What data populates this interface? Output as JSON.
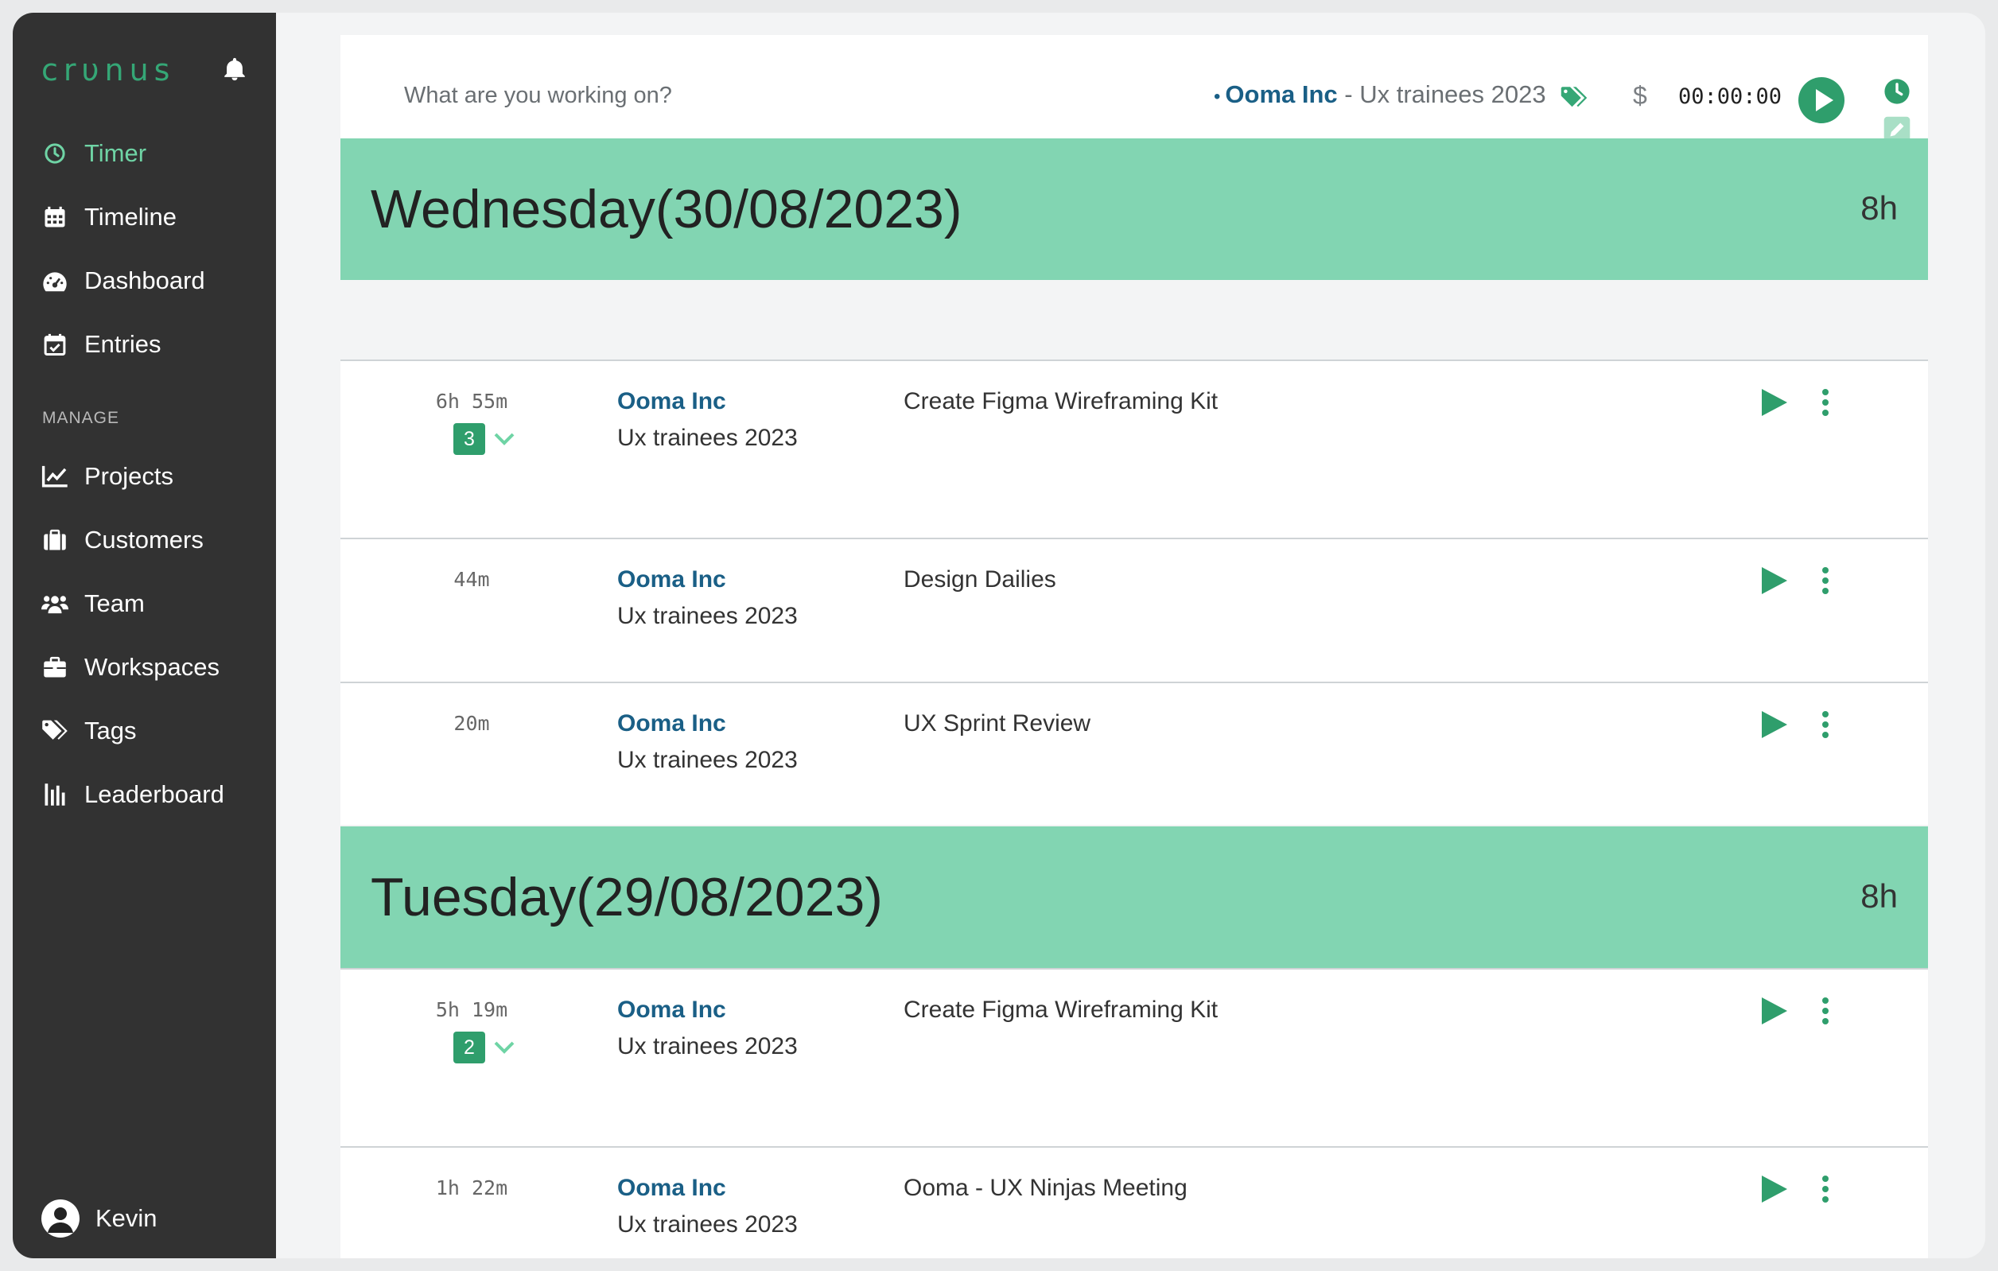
{
  "app": {
    "logo_text": "crυnus",
    "accent": "#35a776",
    "header_green": "#82d5b2",
    "client_color": "#1a5f86"
  },
  "sidebar": {
    "items": [
      {
        "label": "Timer",
        "icon": "clock-icon",
        "active": true
      },
      {
        "label": "Timeline",
        "icon": "calendar-grid-icon"
      },
      {
        "label": "Dashboard",
        "icon": "gauge-icon"
      },
      {
        "label": "Entries",
        "icon": "calendar-check-icon"
      }
    ],
    "section_label": "MANAGE",
    "manage_items": [
      {
        "label": "Projects",
        "icon": "chart-line-icon"
      },
      {
        "label": "Customers",
        "icon": "clipboard-icon"
      },
      {
        "label": "Team",
        "icon": "users-icon"
      },
      {
        "label": "Workspaces",
        "icon": "briefcase-icon"
      },
      {
        "label": "Tags",
        "icon": "tags-icon"
      },
      {
        "label": "Leaderboard",
        "icon": "bars-icon"
      }
    ],
    "user_name": "Kevin"
  },
  "timer": {
    "placeholder": "What are you working on?",
    "client": "Ooma Inc",
    "separator": "-",
    "project": "Ux trainees 2023",
    "billable_symbol": "$",
    "elapsed": "00:00:00"
  },
  "days": [
    {
      "title": "Wednesday(30/08/2023)",
      "total": "8h",
      "entries": [
        {
          "duration": "6h 55m",
          "count": "3",
          "client": "Ooma Inc",
          "project": "Ux trainees 2023",
          "description": "Create Figma Wireframing Kit"
        },
        {
          "duration": "44m",
          "client": "Ooma Inc",
          "project": "Ux trainees 2023",
          "description": "Design Dailies"
        },
        {
          "duration": "20m",
          "client": "Ooma Inc",
          "project": "Ux trainees 2023",
          "description": "UX Sprint Review"
        }
      ]
    },
    {
      "title": "Tuesday(29/08/2023)",
      "total": "8h",
      "entries": [
        {
          "duration": "5h 19m",
          "count": "2",
          "client": "Ooma Inc",
          "project": "Ux trainees 2023",
          "description": "Create Figma Wireframing Kit"
        },
        {
          "duration": "1h 22m",
          "client": "Ooma Inc",
          "project": "Ux trainees 2023",
          "description": "Ooma - UX Ninjas Meeting"
        }
      ]
    }
  ]
}
